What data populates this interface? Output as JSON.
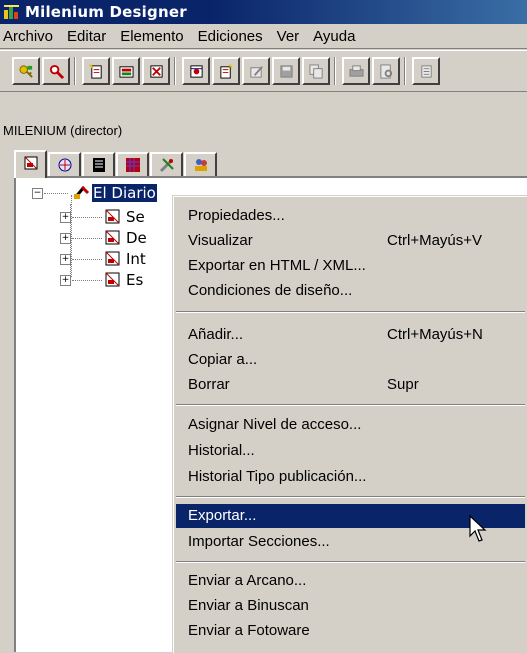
{
  "window": {
    "title": "Milenium Designer",
    "title_bar_color": "#0a246a",
    "icon": "milenium-app-icon"
  },
  "menubar": {
    "items": [
      "Archivo",
      "Editar",
      "Elemento",
      "Ediciones",
      "Ver",
      "Ayuda"
    ]
  },
  "toolbar": {
    "buttons": [
      "key-icon",
      "search-icon",
      "new-page-icon",
      "new-publication-icon",
      "delete-icon",
      "properties-icon",
      "paste-icon",
      "edit-icon",
      "save-icon",
      "copy-icon",
      "print-icon",
      "print-preview-icon",
      "more-icon"
    ]
  },
  "session": {
    "user_label": "MILENIUM (director)"
  },
  "tabs": [
    "publication-icon",
    "sections-icon",
    "pages-icon",
    "grid-icon",
    "tools-icon",
    "people-icon"
  ],
  "tree": {
    "root": {
      "label": "El Diario",
      "expander": "−",
      "selected": true
    },
    "children": [
      {
        "label": "Se",
        "expander": "+"
      },
      {
        "label": "De",
        "expander": "+"
      },
      {
        "label": "Int",
        "expander": "+"
      },
      {
        "label": "Es",
        "expander": "+"
      }
    ]
  },
  "context_menu": {
    "groups": [
      [
        {
          "label": "Propiedades...",
          "shortcut": ""
        },
        {
          "label": "Visualizar",
          "shortcut": "Ctrl+Mayús+V"
        },
        {
          "label": "Exportar en HTML / XML...",
          "shortcut": ""
        },
        {
          "label": "Condiciones de diseño...",
          "shortcut": ""
        }
      ],
      [
        {
          "label": "Añadir...",
          "shortcut": "Ctrl+Mayús+N"
        },
        {
          "label": "Copiar a...",
          "shortcut": ""
        },
        {
          "label": "Borrar",
          "shortcut": "Supr"
        }
      ],
      [
        {
          "label": "Asignar Nivel de acceso...",
          "shortcut": ""
        },
        {
          "label": "Historial...",
          "shortcut": ""
        },
        {
          "label": "Historial Tipo publicación...",
          "shortcut": ""
        }
      ],
      [
        {
          "label": "Exportar...",
          "shortcut": "",
          "highlighted": true
        },
        {
          "label": "Importar Secciones...",
          "shortcut": ""
        }
      ],
      [
        {
          "label": "Enviar a Arcano...",
          "shortcut": ""
        },
        {
          "label": "Enviar a Binuscan",
          "shortcut": ""
        },
        {
          "label": "Enviar a Fotoware",
          "shortcut": ""
        }
      ]
    ],
    "highlight_color": "#0a246a"
  }
}
